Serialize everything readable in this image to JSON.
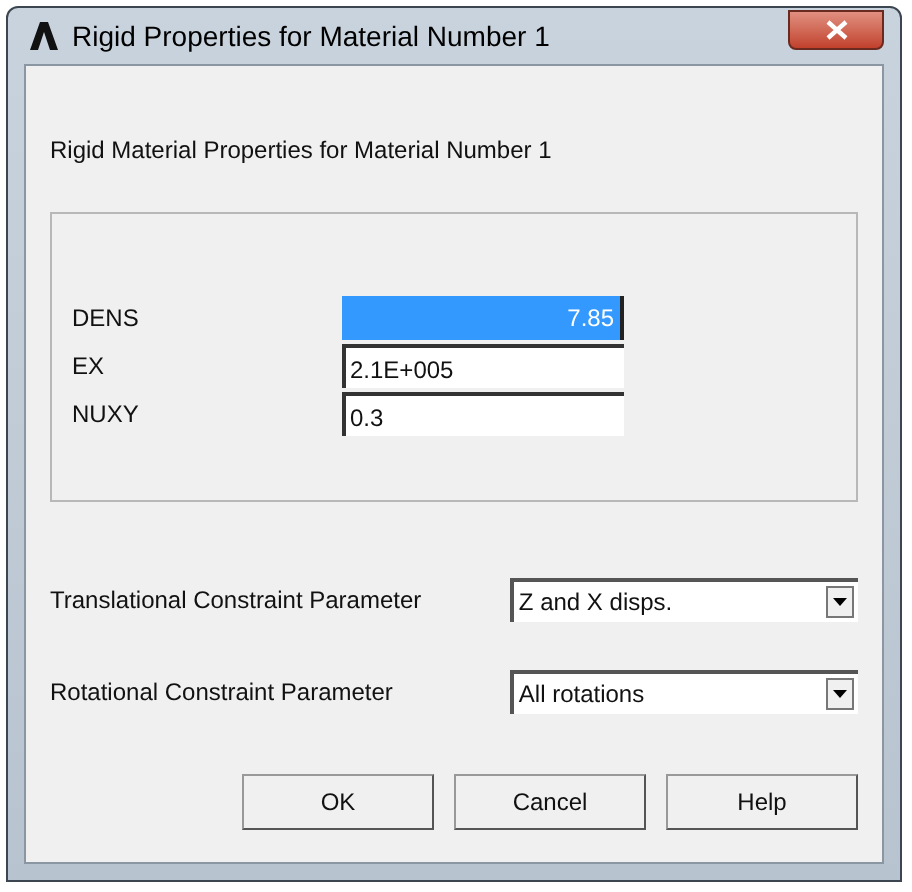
{
  "window": {
    "title": "Rigid Properties for Material Number 1"
  },
  "heading": "Rigid Material Properties for Material Number 1",
  "properties": [
    {
      "label": "DENS",
      "value": "7.85",
      "selected": true
    },
    {
      "label": "EX",
      "value": "2.1E+005",
      "selected": false
    },
    {
      "label": "NUXY",
      "value": "0.3",
      "selected": false
    }
  ],
  "constraints": [
    {
      "label": "Translational Constraint Parameter",
      "value": "Z and X disps."
    },
    {
      "label": "Rotational Constraint Parameter",
      "value": "All rotations"
    }
  ],
  "buttons": [
    "OK",
    "Cancel",
    "Help"
  ]
}
